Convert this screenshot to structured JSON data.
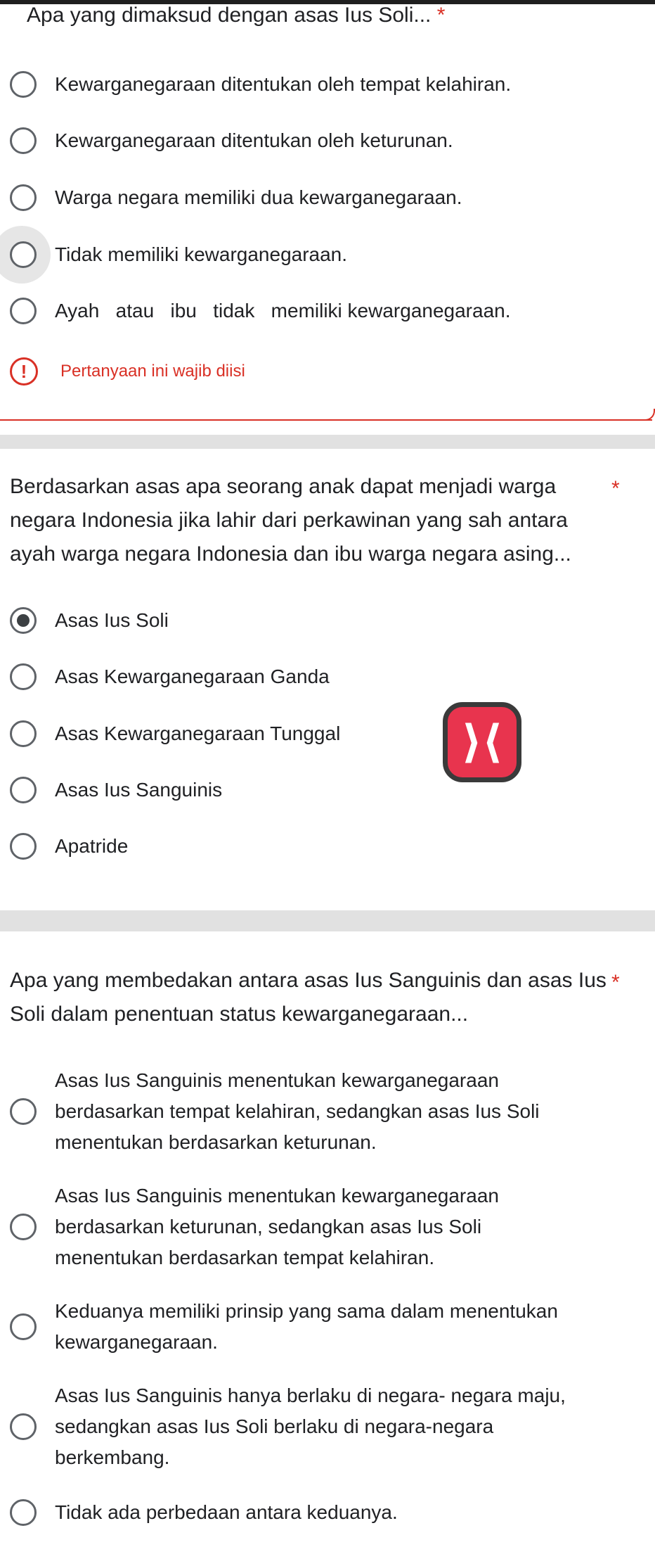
{
  "q1": {
    "title": "Apa yang dimaksud dengan asas Ius Soli...",
    "required_star": "*",
    "options": [
      "Kewarganegaraan ditentukan oleh tempat kelahiran.",
      "Kewarganegaraan ditentukan oleh keturunan.",
      "Warga negara memiliki dua kewarganegaraan.",
      "Tidak memiliki kewarganegaraan.",
      "Ayah   atau   ibu   tidak   memiliki kewarganegaraan."
    ],
    "error_icon": "!",
    "error_text": "Pertanyaan ini wajib diisi"
  },
  "q2": {
    "title": "Berdasarkan asas apa seorang anak dapat menjadi warga negara Indonesia jika lahir dari perkawinan yang sah antara ayah warga negara Indonesia dan ibu warga negara asing...",
    "required_star": "*",
    "options": [
      "Asas Ius Soli",
      "Asas Kewarganegaraan Ganda",
      "Asas Kewarganegaraan Tunggal",
      "Asas Ius Sanguinis",
      "Apatride"
    ],
    "selected_index": 0
  },
  "q3": {
    "title": "Apa yang membedakan antara asas Ius Sanguinis dan asas Ius Soli dalam penentuan status kewarganegaraan...",
    "required_star": "*",
    "options": [
      "Asas Ius Sanguinis menentukan kewarganegaraan berdasarkan tempat kelahiran, sedangkan asas Ius Soli menentukan berdasarkan keturunan.",
      "Asas Ius Sanguinis menentukan kewarganegaraan berdasarkan keturunan, sedangkan asas Ius Soli menentukan berdasarkan tempat kelahiran.",
      "Keduanya memiliki prinsip yang sama dalam menentukan kewarganegaraan.",
      "Asas Ius Sanguinis hanya berlaku di negara- negara maju, sedangkan asas Ius Soli berlaku di negara-negara berkembang.",
      "Tidak ada perbedaan antara keduanya."
    ]
  },
  "floating_button": {
    "icon": "x-logo-icon",
    "glyph": "⟩⟨",
    "color": "#e8344e"
  },
  "colors": {
    "error": "#d93025",
    "text": "#202124",
    "radio": "#5f6368",
    "separator": "#e1e1e1"
  }
}
